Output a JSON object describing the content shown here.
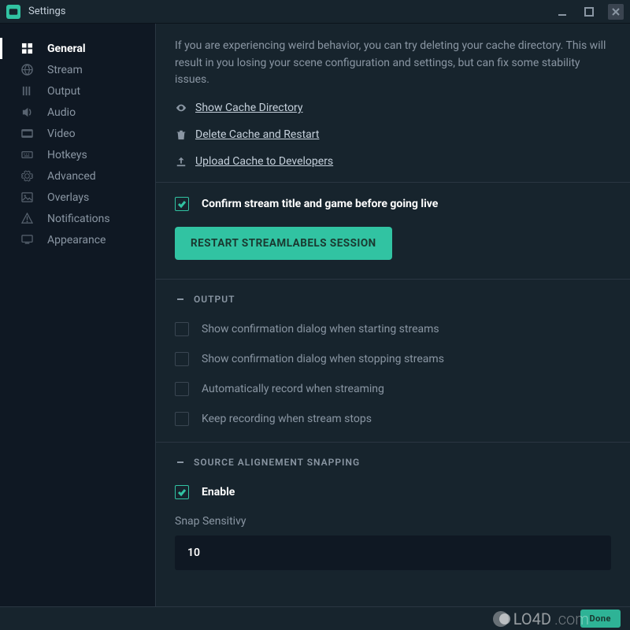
{
  "titlebar": {
    "title": "Settings"
  },
  "sidebar": {
    "items": [
      {
        "label": "General"
      },
      {
        "label": "Stream"
      },
      {
        "label": "Output"
      },
      {
        "label": "Audio"
      },
      {
        "label": "Video"
      },
      {
        "label": "Hotkeys"
      },
      {
        "label": "Advanced"
      },
      {
        "label": "Overlays"
      },
      {
        "label": "Notifications"
      },
      {
        "label": "Appearance"
      }
    ]
  },
  "cache": {
    "desc": "If you are experiencing weird behavior, you can try deleting your cache directory. This will result in you losing your scene configuration and settings, but can fix some stability issues.",
    "show_link": "Show Cache Directory",
    "delete_link": "Delete Cache and Restart",
    "upload_link": "Upload Cache to Developers"
  },
  "confirm": {
    "label": "Confirm stream title and game before going live",
    "checked": true,
    "restart_button": "Restart Streamlabels Session"
  },
  "output_section": {
    "header": "OUTPUT",
    "items": [
      {
        "label": "Show confirmation dialog when starting streams",
        "checked": false
      },
      {
        "label": "Show confirmation dialog when stopping streams",
        "checked": false
      },
      {
        "label": "Automatically record when streaming",
        "checked": false
      },
      {
        "label": "Keep recording when stream stops",
        "checked": false
      }
    ]
  },
  "snap": {
    "header": "SOURCE ALIGNEMENT SNAPPING",
    "enable_label": "Enable",
    "enable_checked": true,
    "sensitivity_label": "Snap Sensitivy",
    "sensitivity_value": "10"
  },
  "footer": {
    "done": "Done"
  },
  "watermark": {
    "text": "LO4D",
    "tld": ".com"
  }
}
